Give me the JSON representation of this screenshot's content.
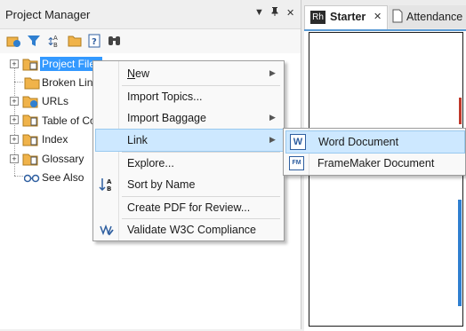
{
  "left_panel": {
    "title": "Project Manager",
    "header_buttons": {
      "dropdown": "▼",
      "pin": "ᵖ",
      "close": "✕"
    },
    "tree": [
      {
        "label": "Project Files",
        "expanded": false,
        "selected": true
      },
      {
        "label": "Broken Links"
      },
      {
        "label": "URLs"
      },
      {
        "label": "Table of Co"
      },
      {
        "label": "Index"
      },
      {
        "label": "Glossary"
      },
      {
        "label": "See Also"
      }
    ]
  },
  "tabs": [
    {
      "label": "Starter",
      "badge": "Rh",
      "close": "✕",
      "active": true
    },
    {
      "label": "Attendance",
      "active": false
    }
  ],
  "context_menu": {
    "items": [
      {
        "label": "New",
        "submenu": true
      },
      {
        "label": "Import Topics...",
        "submenu": false
      },
      {
        "label": "Import Baggage",
        "submenu": true
      },
      {
        "label": "Link",
        "submenu": true,
        "highlighted": true
      },
      {
        "label": "Explore...",
        "submenu": false
      },
      {
        "label": "Sort by Name",
        "submenu": false,
        "icon": "sort-az-icon"
      },
      {
        "label": "Create PDF for Review...",
        "submenu": false
      },
      {
        "label": "Validate W3C Compliance",
        "submenu": false,
        "icon": "w3c-check-icon"
      }
    ]
  },
  "link_submenu": {
    "items": [
      {
        "label": "Word Document",
        "badge": "W",
        "highlighted": true
      },
      {
        "label": "FrameMaker Document",
        "badge": "FM"
      }
    ]
  },
  "colors": {
    "selection": "#3399ff",
    "menu_highlight": "#cde8ff",
    "folder": "#f0b34a",
    "tab_accent": "#5a9bd5",
    "rh_badge": "#2b2b2b"
  }
}
